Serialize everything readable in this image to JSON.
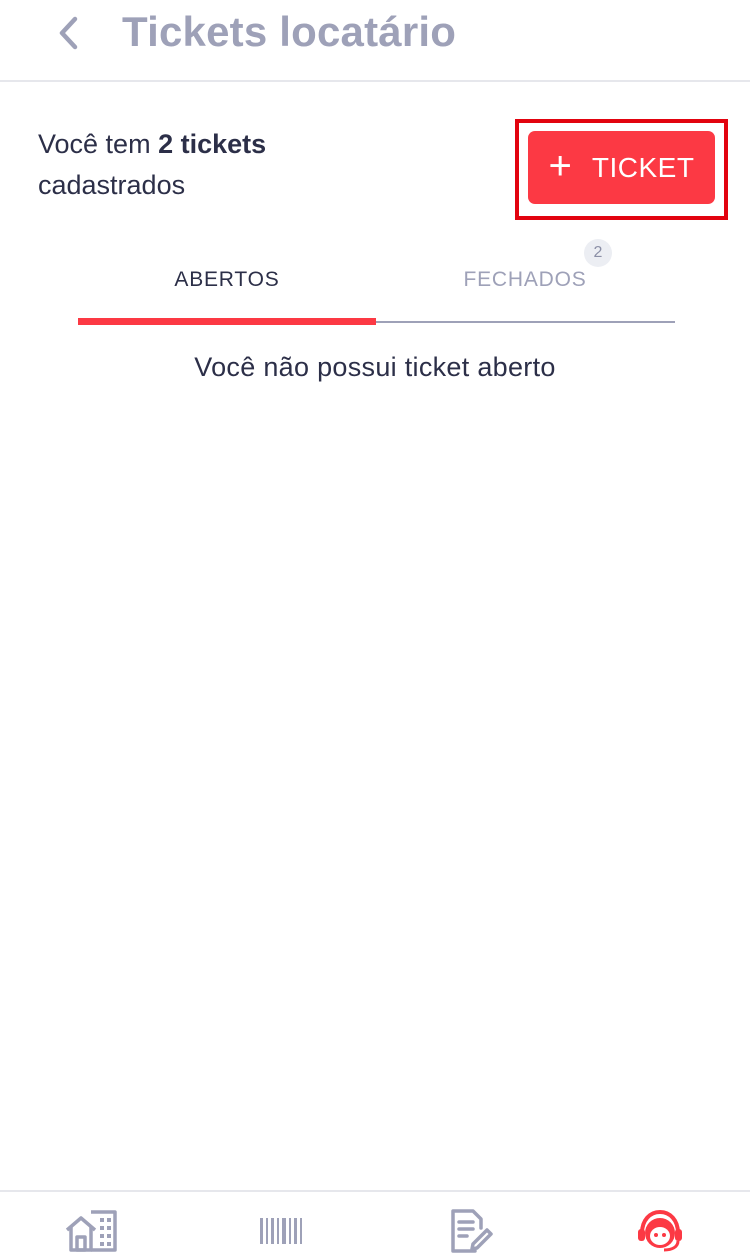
{
  "header": {
    "title": "Tickets locatário",
    "back_icon": "chevron-left-icon"
  },
  "summary": {
    "prefix": "Você tem ",
    "count_text": "2 tickets",
    "suffix": "cadastrados"
  },
  "new_ticket_button": {
    "plus": "+",
    "label": "TICKET"
  },
  "tabs": [
    {
      "label": "ABERTOS",
      "active": true
    },
    {
      "label": "FECHADOS",
      "active": false,
      "badge": "2"
    }
  ],
  "empty_message": "Você não possui ticket aberto",
  "bottom_nav": [
    {
      "icon": "building-home-icon",
      "active": false
    },
    {
      "icon": "barcode-icon",
      "active": false
    },
    {
      "icon": "contract-edit-icon",
      "active": false
    },
    {
      "icon": "support-agent-icon",
      "active": true
    }
  ],
  "colors": {
    "accent": "#fc3944",
    "highlight_outline": "#e2030f",
    "title_gray": "#9ea1b8",
    "text_dark": "#2c2f48"
  }
}
